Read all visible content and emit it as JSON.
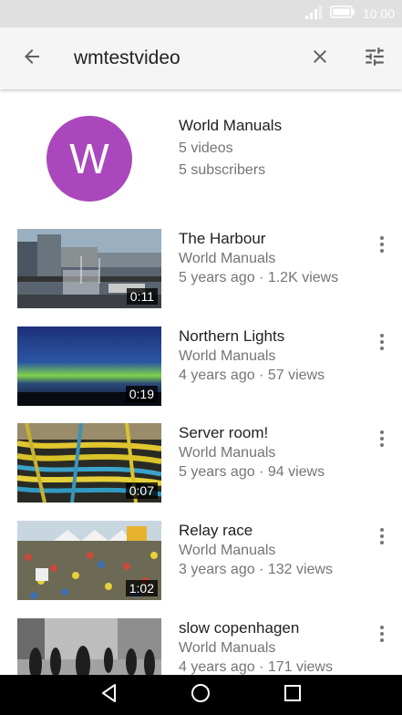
{
  "status_bar": {
    "time": "10:00"
  },
  "search": {
    "query": "wmtestvideo"
  },
  "channel": {
    "avatar_letter": "W",
    "avatar_color": "#ab47bc",
    "name": "World Manuals",
    "videos": "5 videos",
    "subscribers": "5 subscribers"
  },
  "videos": [
    {
      "title": "The Harbour",
      "channel": "World Manuals",
      "meta": "5 years ago · 1.2K views",
      "duration": "0:11"
    },
    {
      "title": "Northern Lights",
      "channel": "World Manuals",
      "meta": "4 years ago · 57 views",
      "duration": "0:19"
    },
    {
      "title": "Server room!",
      "channel": "World Manuals",
      "meta": "5 years ago · 94 views",
      "duration": "0:07"
    },
    {
      "title": "Relay race",
      "channel": "World Manuals",
      "meta": "3 years ago · 132 views",
      "duration": "1:02"
    },
    {
      "title": "slow copenhagen",
      "channel": "World Manuals",
      "meta": "4 years ago · 171 views",
      "duration": ""
    }
  ],
  "icons": {
    "back": "arrow-back-icon",
    "clear": "close-icon",
    "filter": "tune-icon",
    "more": "more-vert-icon",
    "nav_back": "triangle-back-icon",
    "nav_home": "circle-home-icon",
    "nav_recents": "square-recents-icon"
  }
}
